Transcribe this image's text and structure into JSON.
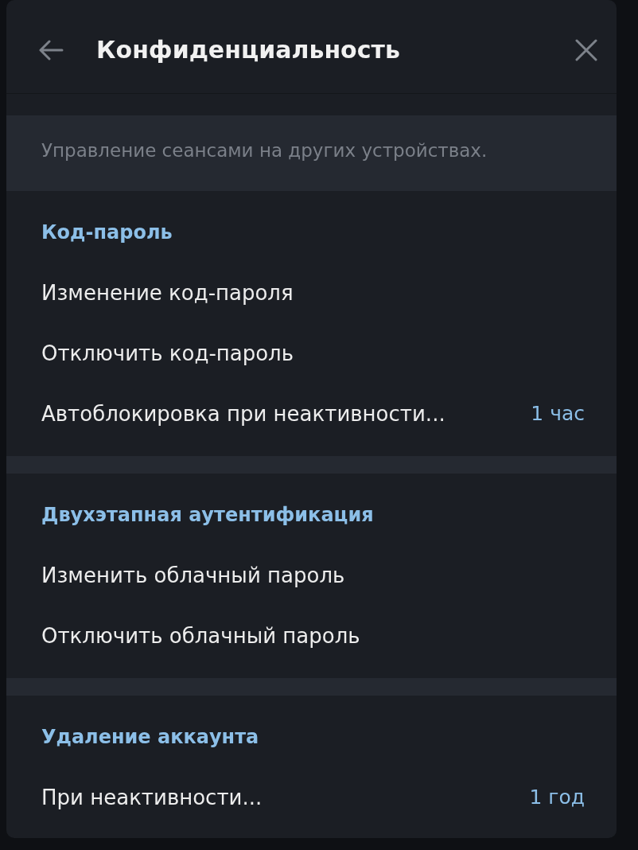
{
  "header": {
    "title": "Конфиденциальность"
  },
  "info_note": "Управление сеансами на других устройствах.",
  "sections": [
    {
      "title": "Код-пароль",
      "items": [
        {
          "label": "Изменение код-пароля"
        },
        {
          "label": "Отключить код-пароль"
        },
        {
          "label": "Автоблокировка при неактивности...",
          "value": "1 час"
        }
      ]
    },
    {
      "title": "Двухэтапная аутентификация",
      "items": [
        {
          "label": "Изменить облачный пароль"
        },
        {
          "label": "Отключить облачный пароль"
        }
      ]
    },
    {
      "title": "Удаление аккаунта",
      "items": [
        {
          "label": "При неактивности...",
          "value": "1 год"
        }
      ]
    }
  ]
}
